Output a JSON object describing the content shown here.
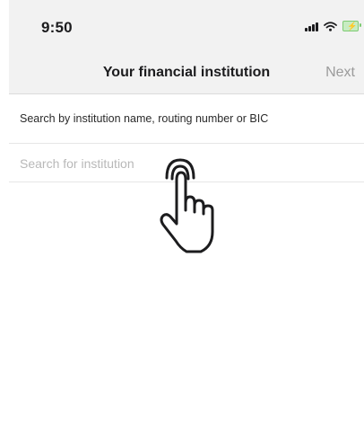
{
  "status_bar": {
    "time": "9:50",
    "icons": [
      "cellular-signal-icon",
      "wifi-icon",
      "battery-charging-icon"
    ],
    "battery_color": "#7ecb74"
  },
  "nav": {
    "title": "Your financial institution",
    "next_label": "Next"
  },
  "search": {
    "label": "Search by institution name, routing number or BIC",
    "placeholder": "Search for institution",
    "value": ""
  },
  "overlay": {
    "icon": "pointing-hand-tap-icon"
  }
}
